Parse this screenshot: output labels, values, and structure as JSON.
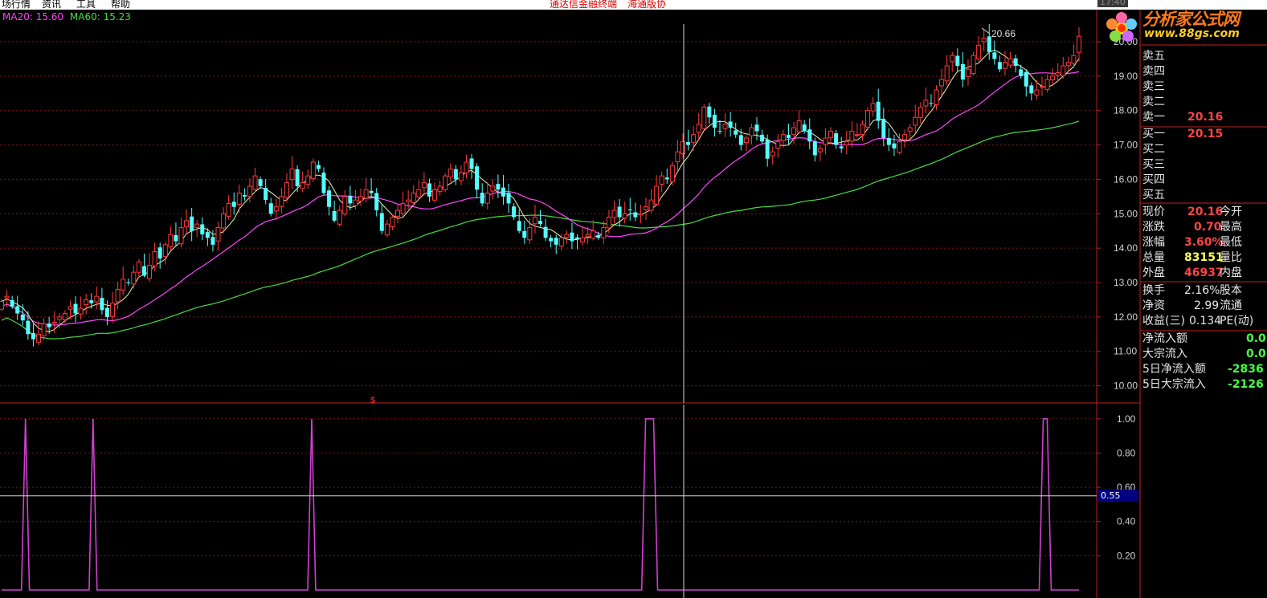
{
  "menu": {
    "items": [
      "场行情",
      "资讯",
      "工具",
      "帮助"
    ],
    "promo_a": "通达信金融终端",
    "promo_b": "海通版协",
    "clock": "17:40"
  },
  "indicator_legend": [
    {
      "label": "MA20: 15.60",
      "color": "#ff44ff"
    },
    {
      "label": "MA60: 15.23",
      "color": "#44dd44"
    }
  ],
  "peak_label": "20.66",
  "signal_marker": "$",
  "logo": {
    "title": "分析家公式网",
    "url": "www.88gs.com"
  },
  "quote_panel": {
    "sell": [
      {
        "label": "卖五",
        "price": ""
      },
      {
        "label": "卖四",
        "price": ""
      },
      {
        "label": "卖三",
        "price": ""
      },
      {
        "label": "卖二",
        "price": ""
      },
      {
        "label": "卖一",
        "price": "20.16"
      }
    ],
    "buy": [
      {
        "label": "买一",
        "price": "20.15"
      },
      {
        "label": "买二",
        "price": ""
      },
      {
        "label": "买三",
        "price": ""
      },
      {
        "label": "买四",
        "price": ""
      },
      {
        "label": "买五",
        "price": ""
      }
    ],
    "stats": [
      {
        "label": "现价",
        "value": "20.16",
        "label2": "今开",
        "cls": "vred"
      },
      {
        "label": "涨跌",
        "value": "0.70",
        "label2": "最高",
        "cls": "vred"
      },
      {
        "label": "涨幅",
        "value": "3.60%",
        "label2": "最低",
        "cls": "vred"
      },
      {
        "label": "总量",
        "value": "83151",
        "label2": "量比",
        "cls": "vyel"
      },
      {
        "label": "外盘",
        "value": "46937",
        "label2": "内盘",
        "cls": "vred"
      }
    ],
    "fundamentals": [
      {
        "label": "换手",
        "value": "2.16%",
        "label2": "股本"
      },
      {
        "label": "净资",
        "value": "2.99",
        "label2": "流通"
      },
      {
        "label": "收益(三)",
        "value": "0.134",
        "label2": "PE(动)"
      }
    ],
    "flows": [
      {
        "label": "净流入额",
        "value": "0.0"
      },
      {
        "label": "大宗流入",
        "value": "0.0"
      },
      {
        "label": "5日净流入额",
        "value": "-2836"
      },
      {
        "label": "5日大宗流入",
        "value": "-2126"
      }
    ]
  },
  "chart_data": [
    {
      "type": "candlestick",
      "ylim": [
        9.5,
        20.7
      ],
      "yticks": [
        "20.00",
        "19.00",
        "18.00",
        "17.00",
        "16.00",
        "15.00",
        "14.00",
        "13.00",
        "12.00",
        "11.00",
        "10.00"
      ],
      "closes": [
        12.45,
        12.6,
        12.3,
        12.1,
        11.9,
        11.5,
        11.35,
        11.5,
        11.8,
        11.7,
        11.85,
        12.0,
        12.1,
        12.3,
        12.1,
        12.25,
        12.5,
        12.4,
        12.6,
        12.2,
        12.0,
        12.4,
        12.8,
        13.1,
        13.0,
        13.3,
        13.6,
        13.2,
        13.5,
        13.9,
        13.7,
        14.1,
        14.4,
        14.2,
        14.6,
        14.8,
        14.5,
        14.7,
        14.4,
        14.3,
        14.1,
        14.6,
        15.0,
        15.3,
        15.2,
        15.6,
        15.5,
        15.8,
        16.1,
        15.8,
        15.4,
        15.0,
        15.2,
        15.5,
        15.9,
        16.3,
        15.8,
        15.9,
        16.1,
        16.5,
        16.3,
        15.6,
        15.2,
        14.8,
        15.1,
        15.5,
        15.3,
        15.4,
        15.5,
        15.7,
        15.6,
        15.1,
        14.5,
        14.7,
        14.9,
        15.1,
        15.3,
        15.4,
        15.6,
        15.7,
        15.9,
        15.5,
        15.7,
        15.8,
        16.1,
        16.3,
        16.0,
        16.2,
        16.5,
        16.3,
        15.7,
        15.3,
        15.6,
        15.8,
        15.7,
        15.5,
        15.3,
        14.9,
        14.5,
        14.3,
        14.6,
        14.9,
        14.7,
        14.3,
        14.2,
        14.1,
        14.3,
        14.4,
        14.2,
        14.25,
        14.3,
        14.4,
        14.5,
        14.3,
        14.6,
        14.9,
        15.1,
        14.9,
        15.0,
        15.1,
        14.9,
        15.0,
        15.2,
        15.4,
        15.8,
        16.1,
        16.0,
        16.4,
        16.8,
        17.1,
        17.0,
        17.3,
        17.6,
        18.1,
        17.8,
        17.5,
        17.4,
        17.6,
        17.5,
        17.3,
        17.0,
        17.2,
        17.5,
        17.4,
        17.1,
        16.6,
        16.8,
        17.1,
        17.3,
        17.2,
        17.5,
        17.7,
        17.4,
        17.1,
        16.7,
        16.9,
        17.2,
        17.4,
        17.0,
        16.9,
        17.1,
        17.4,
        17.3,
        17.6,
        18.0,
        18.2,
        17.7,
        17.2,
        17.0,
        16.9,
        17.1,
        17.3,
        17.5,
        17.8,
        18.1,
        18.3,
        18.2,
        18.6,
        18.9,
        19.3,
        19.6,
        19.3,
        18.9,
        19.2,
        19.6,
        19.9,
        20.1,
        19.7,
        19.5,
        19.2,
        19.4,
        19.5,
        19.3,
        19.0,
        18.7,
        18.5,
        18.6,
        18.7,
        18.9,
        19.0,
        19.1,
        19.3,
        19.4,
        19.6,
        20.16
      ]
    },
    {
      "type": "line",
      "ylim": [
        0,
        1.06
      ],
      "yticks": [
        "1.00",
        "0.80",
        "0.60",
        "0.40",
        "0.20"
      ],
      "readout": "0.55",
      "values": [
        0,
        0,
        0,
        0,
        0,
        0,
        1,
        0,
        0,
        0,
        0,
        0,
        0,
        0,
        0,
        0,
        0,
        0,
        0,
        0,
        0,
        0,
        0,
        1,
        0,
        0,
        0,
        0,
        0,
        0,
        0,
        0,
        0,
        0,
        0,
        0,
        0,
        0,
        0,
        0,
        0,
        0,
        0,
        0,
        0,
        0,
        0,
        0,
        0,
        0,
        0,
        0,
        0,
        0,
        0,
        0,
        0,
        0,
        0,
        0,
        0,
        0,
        0,
        0,
        0,
        0,
        0,
        0,
        0,
        0,
        0,
        0,
        0,
        0,
        0,
        0,
        0,
        0,
        1,
        0,
        0,
        0,
        0,
        0,
        0,
        0,
        0,
        0,
        0,
        0,
        0,
        0,
        0,
        0,
        0,
        0,
        0,
        0,
        0,
        0,
        0,
        0,
        0,
        0,
        0,
        0,
        0,
        0,
        0,
        0,
        0,
        0,
        0,
        0,
        0,
        0,
        0,
        0,
        0,
        0,
        0,
        0,
        0,
        0,
        0,
        0,
        0,
        0,
        0,
        0,
        0,
        0,
        0,
        0,
        0,
        0,
        0,
        0,
        0,
        0,
        0,
        0,
        0,
        0,
        0,
        0,
        0,
        0,
        0,
        0,
        0,
        0,
        0,
        0,
        0,
        0,
        0,
        0,
        0,
        0,
        0,
        0,
        1,
        1,
        1,
        0,
        0,
        0,
        0,
        0,
        0,
        0,
        0,
        0,
        0,
        0,
        0,
        0,
        0,
        0,
        0,
        0,
        0,
        0,
        0,
        0,
        0,
        0,
        0,
        0,
        0,
        0,
        0,
        0,
        0,
        0,
        0,
        0,
        0,
        0,
        0,
        0,
        0,
        0,
        0,
        0,
        0,
        0,
        0,
        0,
        0,
        0,
        0,
        0,
        0,
        0,
        0,
        0,
        0,
        0,
        0,
        0,
        0,
        0,
        0,
        0,
        0,
        0,
        0,
        0,
        0,
        0,
        0,
        0,
        0,
        0,
        0,
        0,
        0,
        0,
        0,
        0,
        0,
        0,
        0,
        0,
        0,
        0,
        0,
        0,
        0,
        0,
        0,
        0,
        0,
        0,
        0,
        0,
        0,
        0,
        0,
        0,
        1,
        1,
        0,
        0,
        0,
        0,
        0,
        0,
        0,
        0
      ]
    }
  ]
}
